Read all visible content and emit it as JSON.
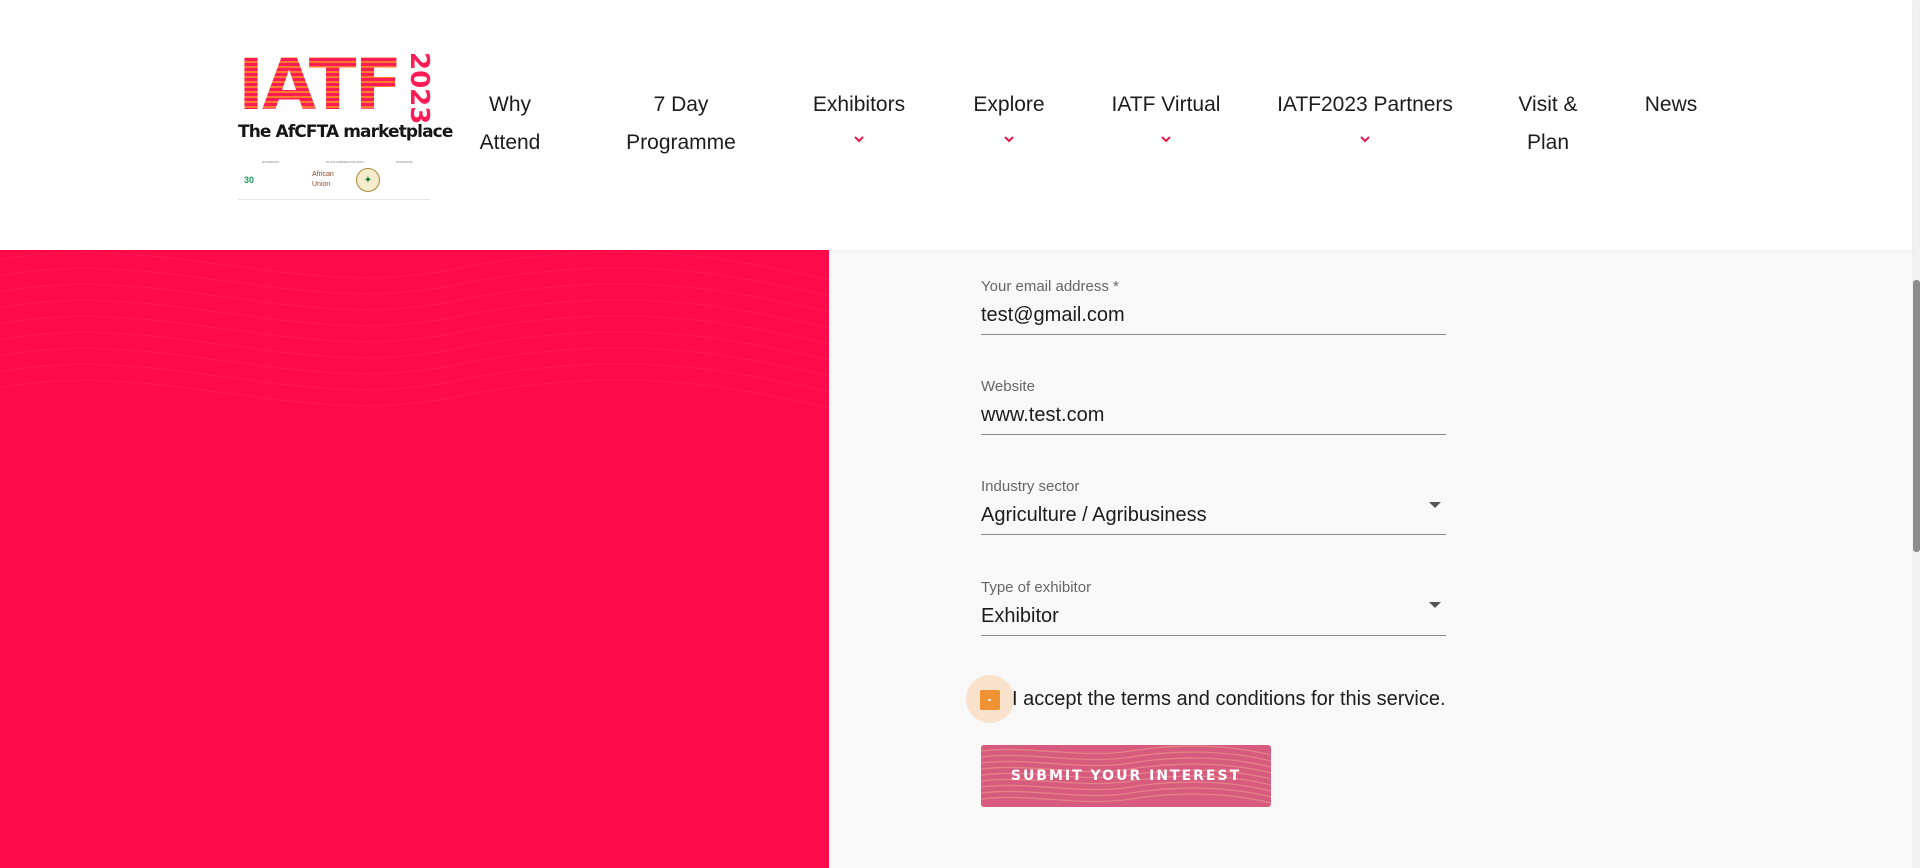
{
  "logo": {
    "main": "IATF",
    "year": "2023",
    "tagline": "The AfCFTA marketplace",
    "partner_captions": [
      "HOSTED BY",
      "IN COLLABORATION WITH",
      "HOSTED BY"
    ],
    "partner_1": "30",
    "partner_2": "African Union"
  },
  "nav": {
    "items": [
      {
        "line1": "Why",
        "line2": "Attend"
      },
      {
        "line1": "7 Day",
        "line2": "Programme"
      },
      {
        "line1": "Exhibitors"
      },
      {
        "line1": "Explore"
      },
      {
        "line1": "IATF Virtual"
      },
      {
        "line1": "IATF2023 Partners"
      },
      {
        "line1": "Visit &",
        "line2": "Plan"
      },
      {
        "line1": "News"
      }
    ]
  },
  "form": {
    "email": {
      "label": "Your email address *",
      "value": "test@gmail.com"
    },
    "website": {
      "label": "Website",
      "value": "www.test.com"
    },
    "industry": {
      "label": "Industry sector",
      "value": "Agriculture / Agribusiness"
    },
    "exhibitor_type": {
      "label": "Type of exhibitor",
      "value": "Exhibitor"
    },
    "terms": {
      "label": "I accept the terms and conditions for this service.",
      "checked": true
    },
    "submit_label": "SUBMIT YOUR INTEREST"
  },
  "colors": {
    "brand_red": "#ff0a4a",
    "checkbox_orange": "#ee9232",
    "button_pink": "#d65b7f"
  }
}
